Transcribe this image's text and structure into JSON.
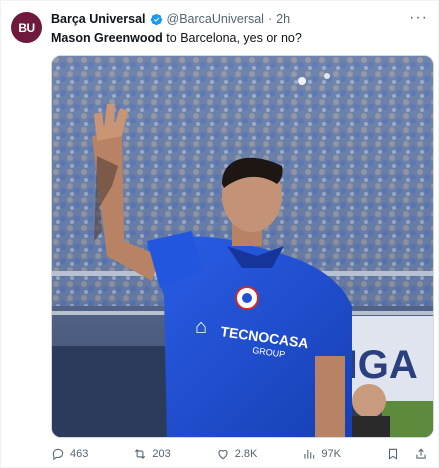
{
  "account": {
    "avatar_text": "BU",
    "name": "Barça Universal",
    "handle": "@BarcaUniversal",
    "separator": "·",
    "time": "2h"
  },
  "tweet": {
    "subject": "Mason Greenwood",
    "rest": " to Barcelona, yes or no?"
  },
  "media": {
    "sponsor_line1": "TECNOCASA",
    "sponsor_line2": "GROUP",
    "banner_text": "LIGA"
  },
  "actions": {
    "replies": "463",
    "reposts": "203",
    "likes": "2.8K",
    "views": "97K"
  },
  "colors": {
    "avatar_bg": "#6d1a3c",
    "verified": "#1d9bf0",
    "shirt": "#1f4fd6"
  }
}
